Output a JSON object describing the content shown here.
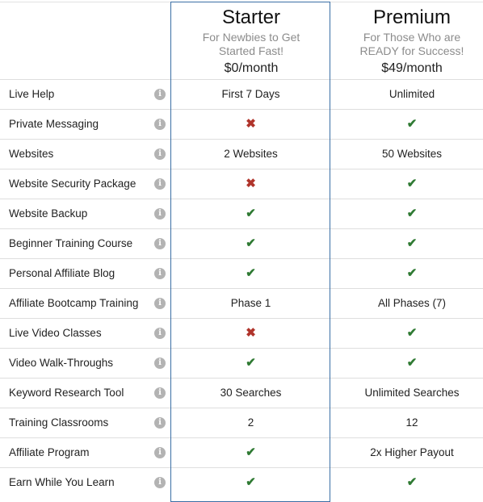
{
  "plans": [
    {
      "name": "Starter",
      "tagline": "For Newbies to Get Started Fast!",
      "price": "$0/month"
    },
    {
      "name": "Premium",
      "tagline": "For Those Who are READY for Success!",
      "price": "$49/month"
    }
  ],
  "icons": {
    "check": "✔",
    "cross": "✖",
    "info": "i"
  },
  "features": [
    {
      "label": "Live Help",
      "starter": "First 7 Days",
      "premium": "Unlimited"
    },
    {
      "label": "Private Messaging",
      "starter": "cross",
      "premium": "check"
    },
    {
      "label": "Websites",
      "starter": "2 Websites",
      "premium": "50 Websites"
    },
    {
      "label": "Website Security Package",
      "starter": "cross",
      "premium": "check"
    },
    {
      "label": "Website Backup",
      "starter": "check",
      "premium": "check"
    },
    {
      "label": "Beginner Training Course",
      "starter": "check",
      "premium": "check"
    },
    {
      "label": "Personal Affiliate Blog",
      "starter": "check",
      "premium": "check"
    },
    {
      "label": "Affiliate Bootcamp Training",
      "starter": "Phase 1",
      "premium": "All Phases (7)"
    },
    {
      "label": "Live Video Classes",
      "starter": "cross",
      "premium": "check"
    },
    {
      "label": "Video Walk-Throughs",
      "starter": "check",
      "premium": "check"
    },
    {
      "label": "Keyword Research Tool",
      "starter": "30 Searches",
      "premium": "Unlimited Searches"
    },
    {
      "label": "Training Classrooms",
      "starter": "2",
      "premium": "12"
    },
    {
      "label": "Affiliate Program",
      "starter": "check",
      "premium": "2x Higher Payout"
    },
    {
      "label": "Earn While You Learn",
      "starter": "check",
      "premium": "check"
    }
  ]
}
